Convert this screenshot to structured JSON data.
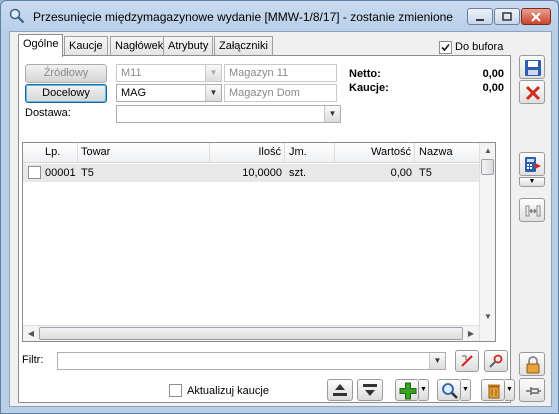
{
  "window": {
    "title": "Przesunięcie międzymagazynowe wydanie [MMW-1/8/17]  - zostanie zmienione"
  },
  "tabs": [
    {
      "label": "Ogólne",
      "active": true
    },
    {
      "label": "Kaucje"
    },
    {
      "label": "Nagłówek"
    },
    {
      "label": "Atrybuty"
    },
    {
      "label": "Załączniki"
    }
  ],
  "do_bufora": {
    "label": "Do bufora",
    "checked": true
  },
  "source": {
    "button": "Źródłowy",
    "code": "M11",
    "name": "Magazyn 11"
  },
  "target": {
    "button": "Docelowy",
    "code": "MAG",
    "name": "Magazyn Dom"
  },
  "dostawa": {
    "label": "Dostawa:",
    "value": ""
  },
  "totals": {
    "netto_label": "Netto:",
    "netto_value": "0,00",
    "kaucje_label": "Kaucje:",
    "kaucje_value": "0,00"
  },
  "grid": {
    "columns": [
      "Lp.",
      "Towar",
      "Ilość",
      "Jm.",
      "Wartość",
      "Nazwa"
    ],
    "rows": [
      {
        "lp": "00001",
        "towar": "T5",
        "ilosc": "10,0000",
        "jm": "szt.",
        "wartosc": "0,00",
        "nazwa": "T5"
      }
    ]
  },
  "filter": {
    "label": "Filtr:",
    "value": ""
  },
  "aktualizuj": {
    "label": "Aktualizuj kaucje",
    "checked": false
  },
  "colors": {
    "title_bg": "#c4d7ee",
    "row_bg": "#e8e8e8",
    "save_blue": "#2b5fae",
    "cancel_red": "#d12b1f",
    "add_green": "#3aa020"
  },
  "icons": {
    "window_icon": "magnifier-icon",
    "save": "floppy-disk-icon",
    "cancel": "red-x-icon",
    "calculator": "calculator-arrow-icon",
    "split": "split-icon",
    "filter_clear": "filter-clear-icon",
    "filter_build": "wrench-filter-icon",
    "upload": "upload-icon",
    "download": "download-icon",
    "add": "plus-icon",
    "preview": "magnifier-icon",
    "delete": "trash-icon",
    "lock": "padlock-icon",
    "pin": "pin-icon"
  }
}
